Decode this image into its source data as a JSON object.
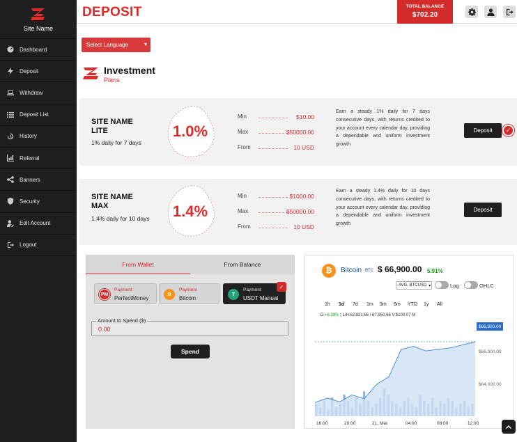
{
  "brand": {
    "name": "Site Name"
  },
  "sidebar": {
    "items": [
      {
        "label": "Dashboard",
        "icon": "dashboard-icon"
      },
      {
        "label": "Deposit",
        "icon": "bolt-icon"
      },
      {
        "label": "Withdraw",
        "icon": "laptop-icon"
      },
      {
        "label": "Deposit List",
        "icon": "list-icon"
      },
      {
        "label": "History",
        "icon": "history-icon"
      },
      {
        "label": "Referral",
        "icon": "chart-icon"
      },
      {
        "label": "Banners",
        "icon": "share-icon"
      },
      {
        "label": "Security",
        "icon": "shield-icon"
      },
      {
        "label": "Edit Account",
        "icon": "user-edit-icon"
      },
      {
        "label": "Logout",
        "icon": "logout-icon"
      }
    ]
  },
  "header": {
    "title": "DEPOSIT",
    "balance_label": "TOTAL BALANCE",
    "balance_value": "$702.20"
  },
  "language": {
    "label": "Select Language"
  },
  "investment": {
    "title": "Investment",
    "subtitle": "Plans"
  },
  "plans": [
    {
      "name": "SITE NAME LITE",
      "desc": "1% daily for 7 days",
      "rate": "1.0%",
      "min_label": "Min",
      "min": "$10.00",
      "max_label": "Max",
      "max": "$50000.00",
      "from_label": "From",
      "from": "10 USD",
      "text": "Earn a steady 1% daily for 7 days consecutive days, with returns credited to your account every calendar day, providing a dependable and uniform investment growth",
      "button": "Deposit",
      "selected": true
    },
    {
      "name": "SITE NAME MAX",
      "desc": "1.4% daily for 10 days",
      "rate": "1.4%",
      "min_label": "Min",
      "min": "$1000.00",
      "max_label": "Max",
      "max": "$50000.00",
      "from_label": "From",
      "from": "10 USD",
      "text": "Earn a steady 1.4% daily for 10 days consecutive days, with returns credited to your account every calendar day, providing a dependable and uniform investment growth",
      "button": "Deposit",
      "selected": false
    }
  ],
  "payment": {
    "tabs": [
      "From Wallet",
      "From Balance"
    ],
    "methods": [
      {
        "label": "Payment",
        "name": "PerfectMoney",
        "icon": "PM"
      },
      {
        "label": "Payment",
        "name": "Bitcoin",
        "icon": "B"
      },
      {
        "label": "Payment",
        "name": "USDT Manual",
        "icon": "T",
        "selected": true
      }
    ],
    "amount_label": "Amount to Spend ($)",
    "amount_value": "0.00",
    "spend_label": "Spend"
  },
  "ticker": {
    "name": "Bitcoin",
    "symbol": "BTC",
    "price": "$ 66,900.00",
    "change": "5.91%",
    "pair": "AVG. BTCUSD",
    "log_label": "Log",
    "ohlc_label": "OHLC",
    "ranges": [
      "1h",
      "1d",
      "7d",
      "1m",
      "3m",
      "6m",
      "YTD",
      "1y",
      "All"
    ],
    "active_range": "1d",
    "stats_d_label": "D:",
    "stats_d": "+6.28%",
    "stats_lh": "L/H:62,821.66 / 67,950.66 V:$100.07 M",
    "price_tag": "$66,900.00",
    "colors": {
      "line": "#4a90d9",
      "fill": "#cfe0f3",
      "volume": "#8fb4e3",
      "accent": "#f7931a"
    }
  },
  "chart_data": {
    "type": "area",
    "x": [
      "16:00",
      "",
      "20:00",
      "",
      "21. Mar.",
      "",
      "04:00",
      "",
      "08:00",
      "",
      "12:00",
      ""
    ],
    "series": [
      {
        "values": [
          62900,
          63200,
          62950,
          63400,
          63150,
          64100,
          64600,
          66400,
          66600,
          66300,
          66400,
          66500,
          66700,
          66900
        ]
      }
    ],
    "y_ticks": [
      "$66,000.00",
      "$64,000.00"
    ],
    "ylim": [
      62000,
      68000
    ],
    "volume": [
      4,
      3,
      5,
      2,
      6,
      3,
      4,
      7,
      5,
      3,
      6,
      4,
      8,
      5,
      3,
      4,
      6,
      9,
      7,
      5,
      4,
      3,
      5,
      6,
      4,
      3,
      7,
      5,
      4,
      6,
      3,
      5,
      4,
      6,
      5,
      3,
      4,
      5,
      3,
      4
    ],
    "reference_line": 66900
  }
}
